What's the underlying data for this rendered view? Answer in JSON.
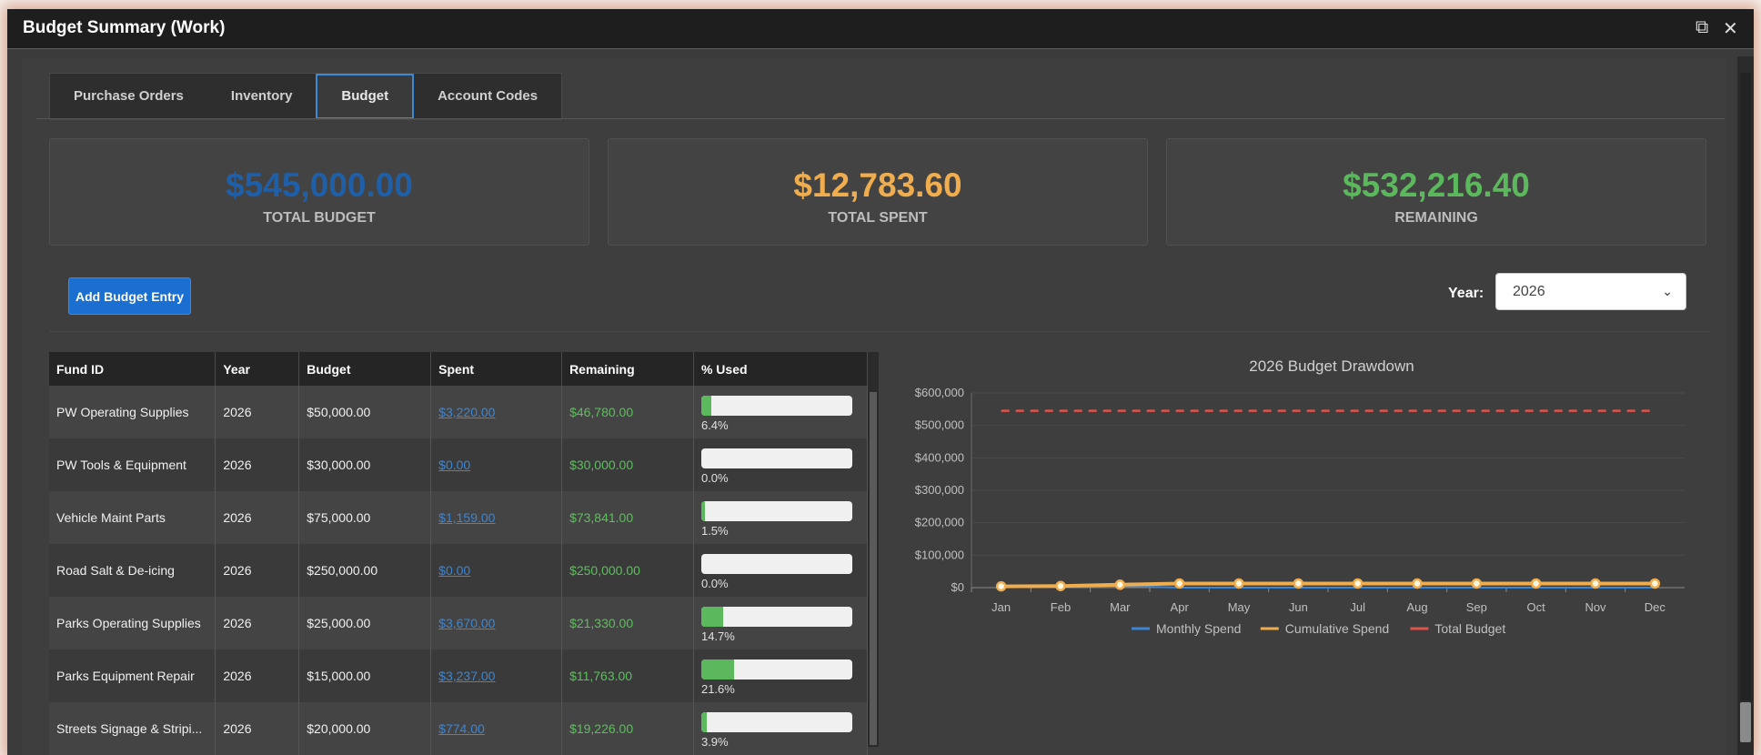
{
  "window": {
    "title": "Budget Summary (Work)"
  },
  "tabs": [
    {
      "label": "Purchase Orders",
      "active": false
    },
    {
      "label": "Inventory",
      "active": false
    },
    {
      "label": "Budget",
      "active": true
    },
    {
      "label": "Account Codes",
      "active": false
    }
  ],
  "cards": {
    "total_budget": {
      "value": "$545,000.00",
      "label": "TOTAL BUDGET",
      "color": "#1f5fa8"
    },
    "total_spent": {
      "value": "$12,783.60",
      "label": "TOTAL SPENT",
      "color": "#f0ad4e"
    },
    "remaining": {
      "value": "$532,216.40",
      "label": "REMAINING",
      "color": "#5cb85c"
    }
  },
  "toolbar": {
    "add_label": "Add Budget Entry",
    "year_label": "Year:",
    "year_value": "2026"
  },
  "table": {
    "headers": [
      "Fund ID",
      "Year",
      "Budget",
      "Spent",
      "Remaining",
      "% Used"
    ],
    "rows": [
      {
        "fund": "PW Operating Supplies",
        "year": "2026",
        "budget": "$50,000.00",
        "spent": "$3,220.00",
        "remaining": "$46,780.00",
        "pct": "6.4%",
        "pct_value": 6.4
      },
      {
        "fund": "PW Tools & Equipment",
        "year": "2026",
        "budget": "$30,000.00",
        "spent": "$0.00",
        "remaining": "$30,000.00",
        "pct": "0.0%",
        "pct_value": 0.0
      },
      {
        "fund": "Vehicle Maint Parts",
        "year": "2026",
        "budget": "$75,000.00",
        "spent": "$1,159.00",
        "remaining": "$73,841.00",
        "pct": "1.5%",
        "pct_value": 1.5
      },
      {
        "fund": "Road Salt & De-icing",
        "year": "2026",
        "budget": "$250,000.00",
        "spent": "$0.00",
        "remaining": "$250,000.00",
        "pct": "0.0%",
        "pct_value": 0.0
      },
      {
        "fund": "Parks Operating Supplies",
        "year": "2026",
        "budget": "$25,000.00",
        "spent": "$3,670.00",
        "remaining": "$21,330.00",
        "pct": "14.7%",
        "pct_value": 14.7
      },
      {
        "fund": "Parks Equipment Repair",
        "year": "2026",
        "budget": "$15,000.00",
        "spent": "$3,237.00",
        "remaining": "$11,763.00",
        "pct": "21.6%",
        "pct_value": 21.6
      },
      {
        "fund": "Streets Signage & Stripi...",
        "year": "2026",
        "budget": "$20,000.00",
        "spent": "$774.00",
        "remaining": "$19,226.00",
        "pct": "3.9%",
        "pct_value": 3.9
      }
    ]
  },
  "chart_data": {
    "type": "line",
    "title": "2026 Budget Drawdown",
    "categories": [
      "Jan",
      "Feb",
      "Mar",
      "Apr",
      "May",
      "Jun",
      "Jul",
      "Aug",
      "Sep",
      "Oct",
      "Nov",
      "Dec"
    ],
    "ylim": [
      0,
      600000
    ],
    "yticks": [
      0,
      100000,
      200000,
      300000,
      400000,
      500000,
      600000
    ],
    "ytick_labels": [
      "$0",
      "$100,000",
      "$200,000",
      "$300,000",
      "$400,000",
      "$500,000",
      "$600,000"
    ],
    "grid": true,
    "legend": "bottom",
    "series": [
      {
        "name": "Monthly Spend",
        "color": "#3b86d4",
        "values": [
          4000,
          2500,
          5000,
          0,
          0,
          0,
          0,
          0,
          0,
          0,
          0,
          0
        ]
      },
      {
        "name": "Cumulative Spend",
        "color": "#f0ad4e",
        "values": [
          4000,
          5000,
          9000,
          12783.6,
          12783.6,
          12783.6,
          12783.6,
          12783.6,
          12783.6,
          12783.6,
          12783.6,
          12783.6
        ]
      },
      {
        "name": "Total Budget",
        "color": "#e0534a",
        "values": [
          545000,
          545000,
          545000,
          545000,
          545000,
          545000,
          545000,
          545000,
          545000,
          545000,
          545000,
          545000
        ]
      }
    ]
  }
}
